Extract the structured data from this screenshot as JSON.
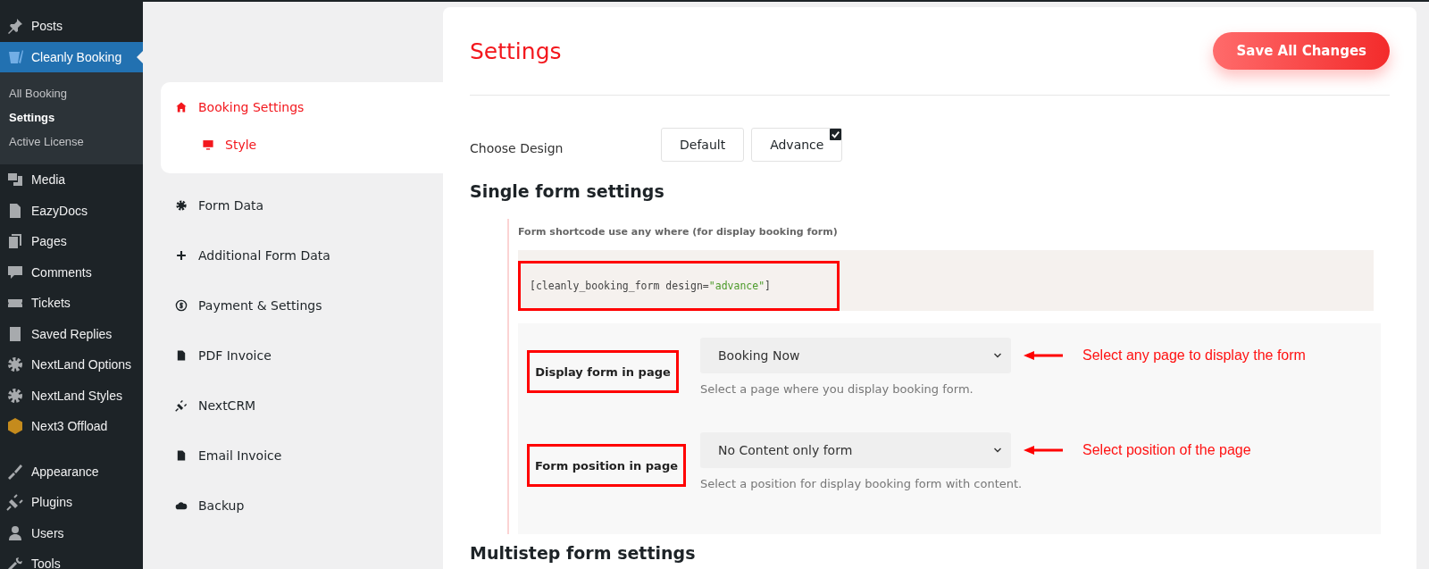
{
  "sidebar": {
    "items": [
      {
        "label": "Posts",
        "selected": false
      },
      {
        "label": "Cleanly Booking",
        "selected": true,
        "children": [
          {
            "label": "All Booking",
            "selected": false
          },
          {
            "label": "Settings",
            "selected": true
          },
          {
            "label": "Active License",
            "selected": false
          }
        ]
      },
      {
        "label": "Media",
        "selected": false
      },
      {
        "label": "EazyDocs",
        "selected": false
      },
      {
        "label": "Pages",
        "selected": false
      },
      {
        "label": "Comments",
        "selected": false
      },
      {
        "label": "Tickets",
        "selected": false
      },
      {
        "label": "Saved Replies",
        "selected": false
      },
      {
        "label": "NextLand Options",
        "selected": false
      },
      {
        "label": "NextLand Styles",
        "selected": false
      },
      {
        "label": "Next3 Offload",
        "selected": false
      },
      {
        "label": "Appearance",
        "selected": false
      },
      {
        "label": "Plugins",
        "selected": false
      },
      {
        "label": "Users",
        "selected": false
      },
      {
        "label": "Tools",
        "selected": false
      }
    ]
  },
  "settings_nav": {
    "items": [
      {
        "label": "Booking Settings",
        "selected": true,
        "children": [
          {
            "label": "Style",
            "selected": true
          }
        ]
      },
      {
        "label": "Form Data",
        "selected": false
      },
      {
        "label": "Additional Form Data",
        "selected": false
      },
      {
        "label": "Payment & Settings",
        "selected": false
      },
      {
        "label": "PDF Invoice",
        "selected": false
      },
      {
        "label": "NextCRM",
        "selected": false
      },
      {
        "label": "Email Invoice",
        "selected": false
      },
      {
        "label": "Backup",
        "selected": false
      }
    ]
  },
  "page": {
    "title": "Settings",
    "save_button": "Save All Changes",
    "choose_design": {
      "label": "Choose Design",
      "options": [
        {
          "label": "Default",
          "selected": false
        },
        {
          "label": "Advance",
          "selected": true
        }
      ]
    },
    "single_form": {
      "heading": "Single form settings",
      "shortcode_label": "Form shortcode use any where (for display booking form)",
      "shortcode": {
        "prefix": "[cleanly_booking_form design=",
        "value": "\"advance\"",
        "suffix": "]"
      },
      "fields": [
        {
          "label": "Display form in page",
          "value": "Booking Now",
          "help": "Select a page where you display booking form.",
          "annotation": "Select any page to display the form"
        },
        {
          "label": "Form position in page",
          "value": "No Content only form",
          "help": "Select a position for display booking form with content.",
          "annotation": "Select position of the page"
        }
      ]
    },
    "multistep_heading": "Multistep form settings"
  }
}
